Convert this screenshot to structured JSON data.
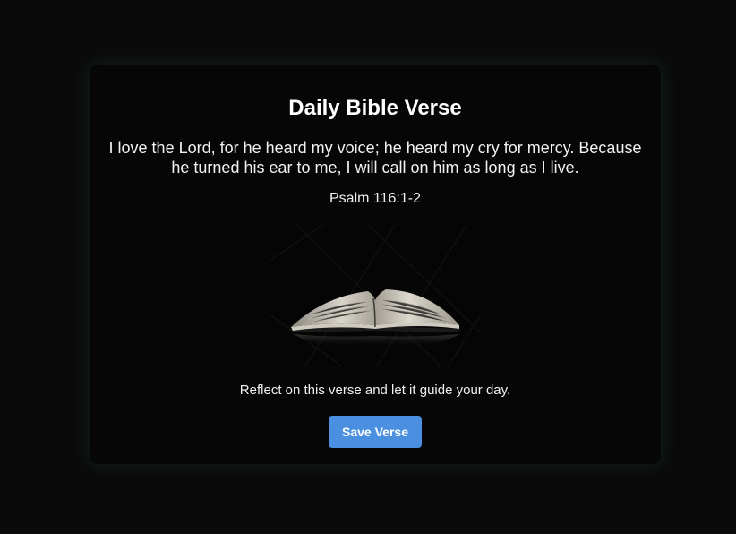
{
  "card": {
    "title": "Daily Bible Verse",
    "verse_text": "I love the Lord, for he heard my voice; he heard my cry for mercy. Because he turned his ear to me, I will call on him as long as I live.",
    "reference": "Psalm 116:1-2",
    "image": {
      "subject": "open-bible"
    },
    "caption": "Reflect on this verse and let it guide your day.",
    "save_button_label": "Save Verse"
  },
  "colors": {
    "page_background": "#0a0a0a",
    "card_background": "#060606",
    "button_background": "#4a8fe0",
    "text": "#ffffff"
  }
}
